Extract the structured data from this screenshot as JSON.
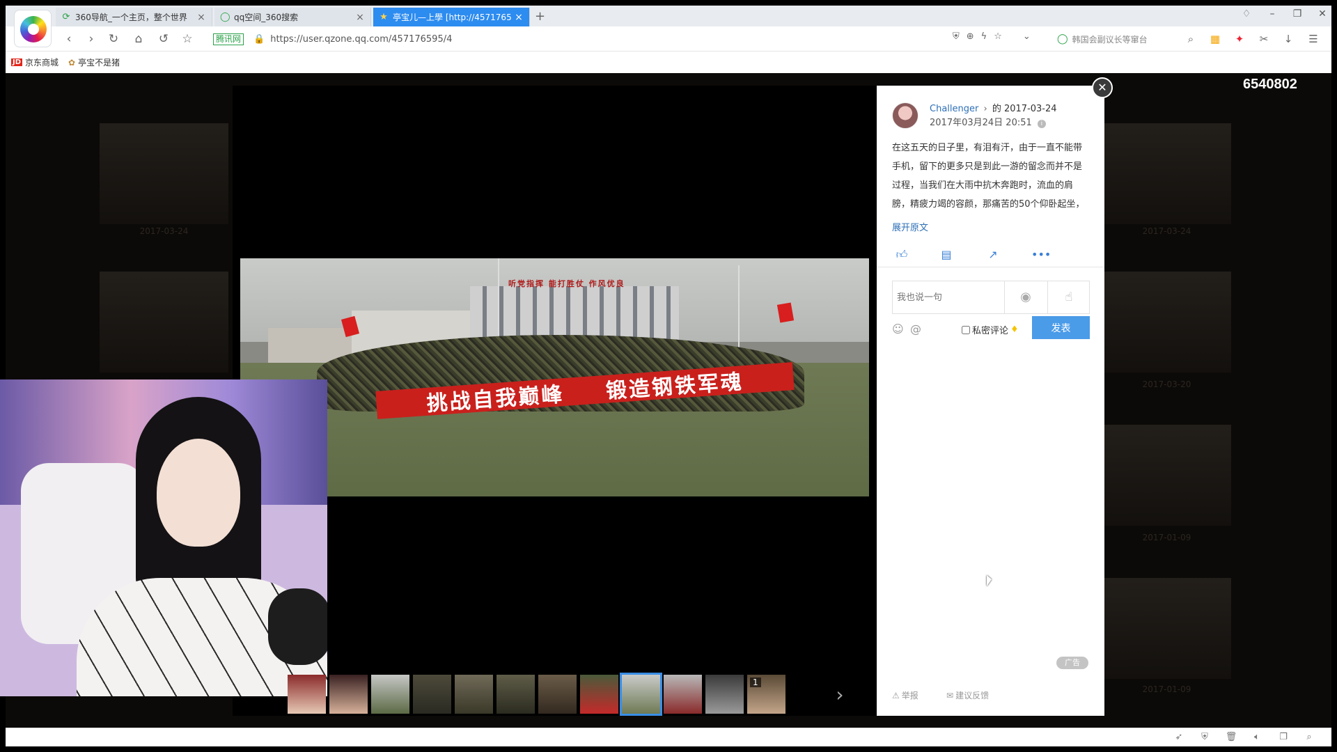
{
  "browser": {
    "tabs": [
      {
        "title": "360导航_一个主页，整个世界",
        "icon": "360-icon"
      },
      {
        "title": "qq空间_360搜索",
        "icon": "search-icon"
      },
      {
        "title": "亭宝儿—上學 [http://4571765",
        "icon": "star-icon"
      }
    ],
    "address": {
      "badge": "腾讯网",
      "url": "https://user.qzone.qq.com/457176595/4"
    },
    "search": {
      "placeholder": "韩国会副议长等窜台"
    },
    "bookmarks": [
      {
        "label": "京东商城",
        "badge": "JD"
      },
      {
        "label": "亭宝不是猪"
      }
    ]
  },
  "page": {
    "view_count": "6540802",
    "bg_dates": [
      "2017-03-24",
      "2017-03-24",
      "2017-03-20",
      "2017-01-09",
      "2017-01-09"
    ]
  },
  "post": {
    "author": "Challenger",
    "date_prefix": "的",
    "date": "2017-03-24",
    "time": "2017年03月24日 20:51",
    "body": "在这五天的日子里，有泪有汗，由于一直不能带手机，留下的更多只是到此一游的留念而并不是过程，当我们在大雨中抗木奔跑时，流血的肩膀，精疲力竭的容颜，那痛苦的50个仰卧起坐，",
    "expand": "展开原文"
  },
  "photo": {
    "banner_left": "挑战自我巅峰",
    "banner_right": "锻造钢铁军魂",
    "building_sign": "听党指挥 能打胜仗 作风优良"
  },
  "comment": {
    "placeholder": "我也说一句",
    "private_label": "私密评论",
    "submit": "发表"
  },
  "thumbnail_strip": {
    "badge": "1"
  },
  "footer": {
    "ad": "广告",
    "report": "举报",
    "feedback": "建议反馈"
  }
}
